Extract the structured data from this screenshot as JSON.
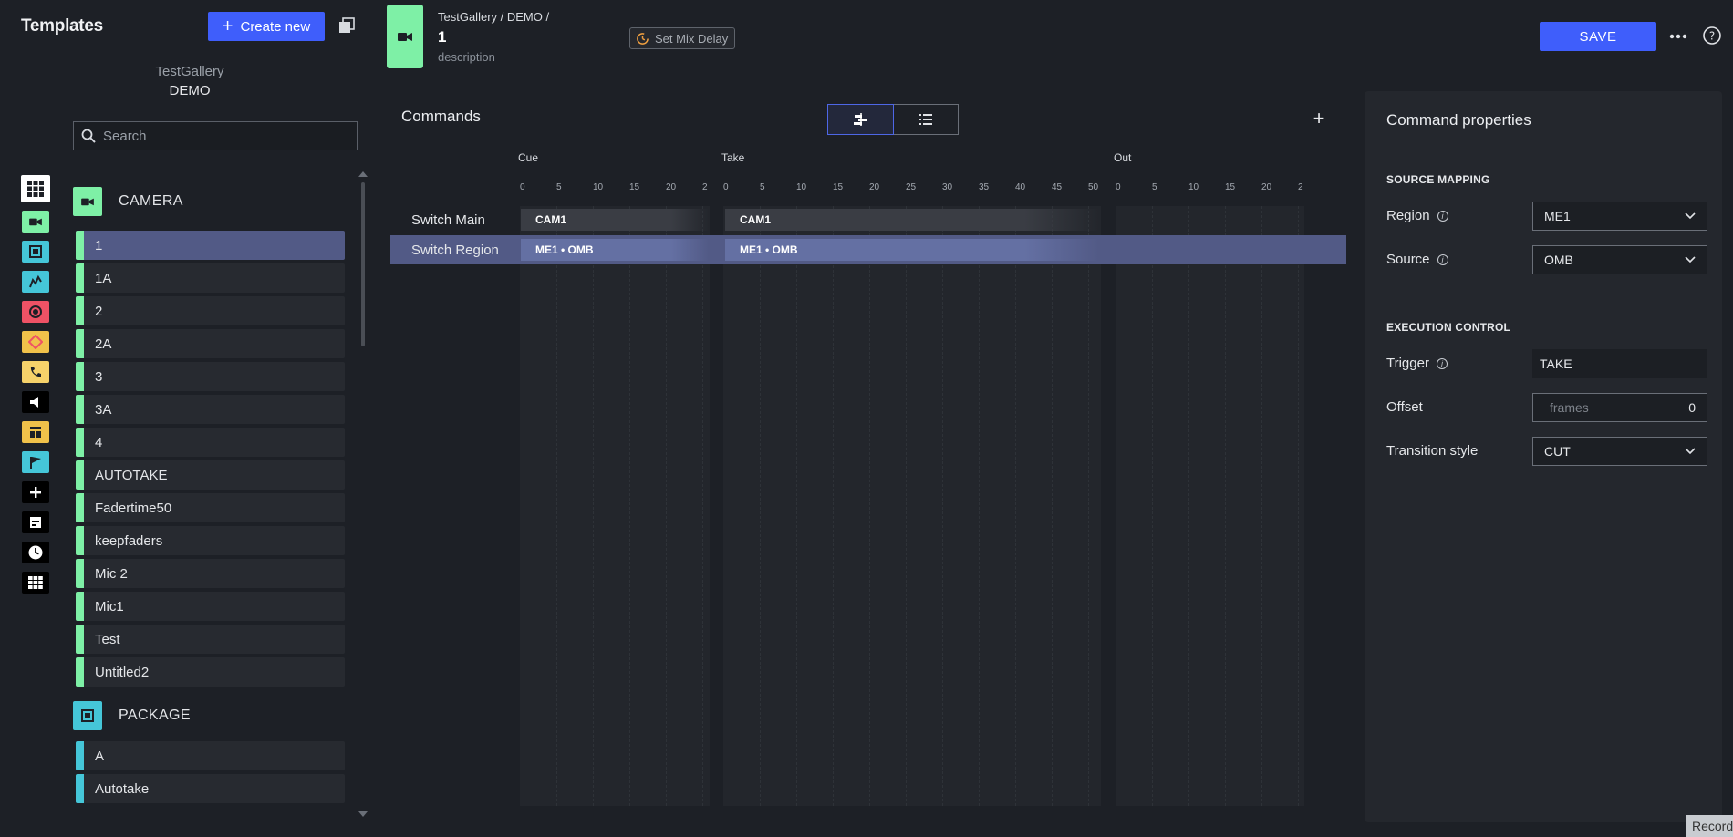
{
  "sidebar": {
    "title": "Templates",
    "create_label": "Create new",
    "gallery": "TestGallery",
    "gallery_sub": "DEMO",
    "search_placeholder": "Search",
    "groups": [
      {
        "label": "CAMERA",
        "color": "#7ef0a6",
        "items": [
          "1",
          "1A",
          "2",
          "2A",
          "3",
          "3A",
          "4",
          "AUTOTAKE",
          "Fadertime50",
          "keepfaders",
          "Mic 2",
          "Mic1",
          "Test",
          "Untitled2"
        ]
      },
      {
        "label": "PACKAGE",
        "color": "#45c6d8",
        "items": [
          "A",
          "Autotake"
        ]
      }
    ],
    "selected_item": "1"
  },
  "category_icons": [
    {
      "name": "all-templates-icon",
      "color": "#ffffff"
    },
    {
      "name": "camera-icon",
      "color": "#7ef0a6"
    },
    {
      "name": "package-icon",
      "color": "#45c6d8"
    },
    {
      "name": "audio-mixer-icon",
      "color": "#45c6d8"
    },
    {
      "name": "record-icon",
      "color": "#ef5265"
    },
    {
      "name": "effects-icon",
      "color": "#f0c14a"
    },
    {
      "name": "phone-icon",
      "color": "#f6d26a"
    },
    {
      "name": "speaker-icon",
      "color": "#000000"
    },
    {
      "name": "layout-icon",
      "color": "#f0c14a"
    },
    {
      "name": "flag-icon",
      "color": "#45c6d8"
    },
    {
      "name": "plus-icon",
      "color": "#000000"
    },
    {
      "name": "graphics-icon",
      "color": "#000000"
    },
    {
      "name": "clock-icon",
      "color": "#000000"
    },
    {
      "name": "grid-icon",
      "color": "#000000"
    }
  ],
  "header": {
    "breadcrumb": "TestGallery / DEMO /",
    "name": "1",
    "description": "description",
    "mix_delay_label": "Set Mix Delay",
    "save_label": "SAVE"
  },
  "commands": {
    "title": "Commands",
    "phases": [
      {
        "label": "Cue",
        "color": "#c9a53b",
        "ticks": [
          "0",
          "5",
          "10",
          "15",
          "20",
          "2"
        ]
      },
      {
        "label": "Take",
        "color": "#c03640",
        "ticks": [
          "0",
          "5",
          "10",
          "15",
          "20",
          "25",
          "30",
          "35",
          "40",
          "45",
          "50"
        ]
      },
      {
        "label": "Out",
        "color": "#7c7f86",
        "ticks": [
          "0",
          "5",
          "10",
          "15",
          "20",
          "2"
        ]
      }
    ],
    "rows": [
      {
        "name": "Switch Main",
        "cue": "CAM1",
        "take": "CAM1"
      },
      {
        "name": "Switch Region",
        "cue": "ME1 • OMB",
        "take": "ME1 • OMB"
      }
    ],
    "selected_row": "Switch Region"
  },
  "properties": {
    "title": "Command properties",
    "source_mapping_title": "SOURCE MAPPING",
    "region_label": "Region",
    "region_value": "ME1",
    "source_label": "Source",
    "source_value": "OMB",
    "execution_title": "EXECUTION CONTROL",
    "trigger_label": "Trigger",
    "trigger_value": "TAKE",
    "offset_label": "Offset",
    "offset_unit": "frames",
    "offset_value": "0",
    "transition_label": "Transition style",
    "transition_value": "CUT"
  },
  "record_label": "Record",
  "accent_color": "#3f5efb"
}
